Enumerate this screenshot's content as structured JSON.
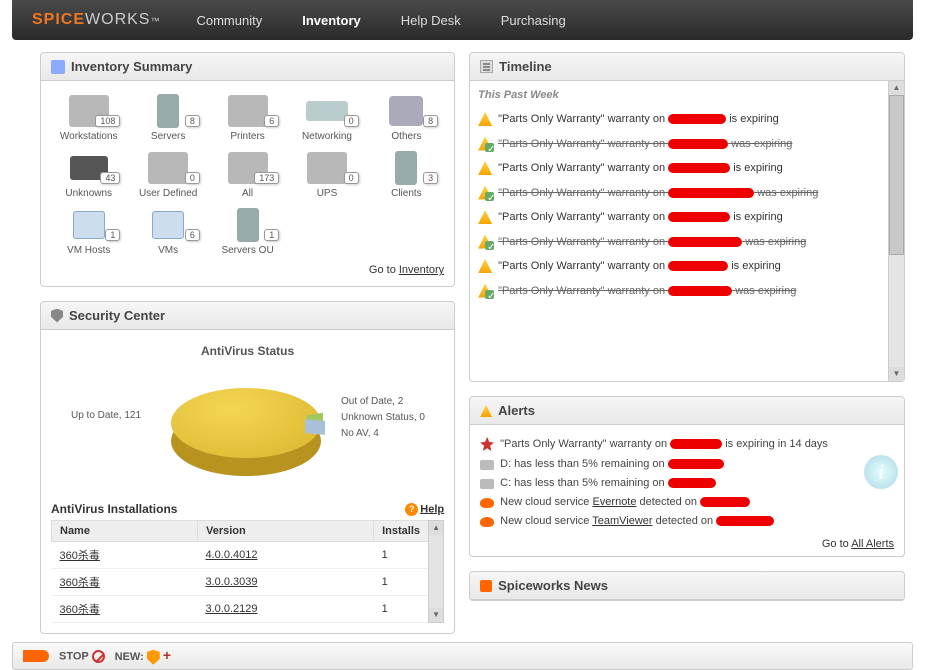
{
  "brand": {
    "part1": "SPICE",
    "part2": "WORKS",
    "tm": "™"
  },
  "nav": {
    "items": [
      "Community",
      "Inventory",
      "Help Desk",
      "Purchasing"
    ],
    "active": 1
  },
  "inventory_summary": {
    "title": "Inventory Summary",
    "items": [
      {
        "label": "Workstations",
        "count": "108"
      },
      {
        "label": "Servers",
        "count": "8"
      },
      {
        "label": "Printers",
        "count": "6"
      },
      {
        "label": "Networking",
        "count": "0"
      },
      {
        "label": "Others",
        "count": "8"
      },
      {
        "label": "Unknowns",
        "count": "43"
      },
      {
        "label": "User Defined",
        "count": "0"
      },
      {
        "label": "All",
        "count": "173"
      },
      {
        "label": "UPS",
        "count": "0"
      },
      {
        "label": "Clients",
        "count": "3"
      },
      {
        "label": "VM Hosts",
        "count": "1"
      },
      {
        "label": "VMs",
        "count": "6"
      },
      {
        "label": "Servers OU",
        "count": "1"
      }
    ],
    "goto_prefix": "Go to ",
    "goto_link": "Inventory"
  },
  "security_center": {
    "title": "Security Center",
    "chart_title": "AntiVirus Status",
    "labels": {
      "uptodate": "Up to Date, 121",
      "outofdate": "Out of Date, 2",
      "unknown": "Unknown Status, 0",
      "noav": "No AV, 4"
    },
    "installs_title": "AntiVirus Installations",
    "help": "Help",
    "cols": {
      "name": "Name",
      "version": "Version",
      "installs": "Installs"
    },
    "rows": [
      {
        "name": "360杀毒",
        "version": "4.0.0.4012",
        "installs": "1"
      },
      {
        "name": "360杀毒",
        "version": "3.0.0.3039",
        "installs": "1"
      },
      {
        "name": "360杀毒",
        "version": "3.0.0.2129",
        "installs": "1"
      }
    ]
  },
  "timeline": {
    "title": "Timeline",
    "section": "This Past Week",
    "expiring_prefix": "\"Parts Only Warranty\" warranty on",
    "expiring_suffix": "is expiring",
    "was_expiring_suffix": "was expiring"
  },
  "alerts": {
    "title": "Alerts",
    "row1_a": "\"Parts Only Warranty\" warranty on",
    "row1_b": "is expiring in 14 days",
    "row2_a": "D: has less than 5% remaining on",
    "row3_a": "C: has less than 5% remaining on",
    "row4_a": "New cloud service",
    "row4_link": "Evernote",
    "row4_b": "detected on",
    "row5_link": "TeamViewer",
    "row5_b": "detected on",
    "goto_prefix": "Go to ",
    "goto_link": "All Alerts"
  },
  "news": {
    "title": "Spiceworks News"
  },
  "bottom": {
    "stop": "STOP",
    "new": "NEW:"
  },
  "chart_data": {
    "type": "pie",
    "title": "AntiVirus Status",
    "categories": [
      "Up to Date",
      "Out of Date",
      "Unknown Status",
      "No AV"
    ],
    "values": [
      121,
      2,
      0,
      4
    ]
  }
}
